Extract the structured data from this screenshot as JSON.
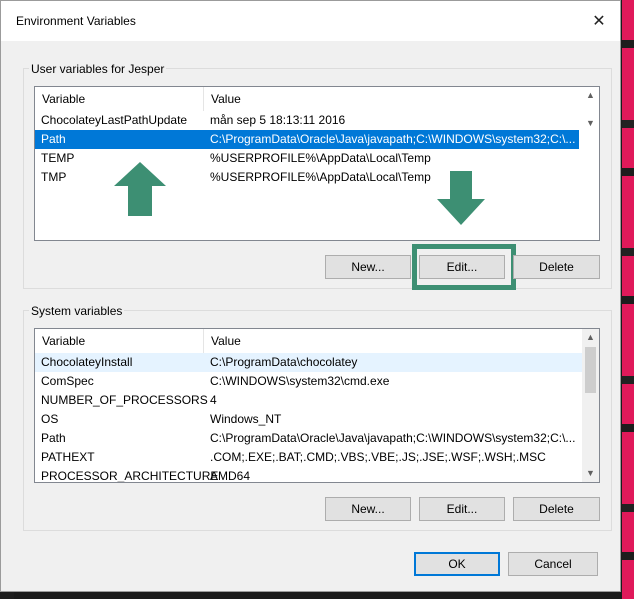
{
  "window": {
    "title": "Environment Variables",
    "close_glyph": "✕"
  },
  "user_group": {
    "label": "User variables for Jesper",
    "columns": [
      "Variable",
      "Value"
    ],
    "rows": [
      {
        "variable": "ChocolateyLastPathUpdate",
        "value": "mån sep  5 18:13:11 2016"
      },
      {
        "variable": "Path",
        "value": "C:\\ProgramData\\Oracle\\Java\\javapath;C:\\WINDOWS\\system32;C:\\..."
      },
      {
        "variable": "TEMP",
        "value": "%USERPROFILE%\\AppData\\Local\\Temp"
      },
      {
        "variable": "TMP",
        "value": "%USERPROFILE%\\AppData\\Local\\Temp"
      }
    ],
    "selected_row": "Path",
    "buttons": {
      "new": "New...",
      "edit": "Edit...",
      "delete": "Delete"
    }
  },
  "system_group": {
    "label": "System variables",
    "columns": [
      "Variable",
      "Value"
    ],
    "rows": [
      {
        "variable": "ChocolateyInstall",
        "value": "C:\\ProgramData\\chocolatey"
      },
      {
        "variable": "ComSpec",
        "value": "C:\\WINDOWS\\system32\\cmd.exe"
      },
      {
        "variable": "NUMBER_OF_PROCESSORS",
        "value": "4"
      },
      {
        "variable": "OS",
        "value": "Windows_NT"
      },
      {
        "variable": "Path",
        "value": "C:\\ProgramData\\Oracle\\Java\\javapath;C:\\WINDOWS\\system32;C:\\..."
      },
      {
        "variable": "PATHEXT",
        "value": ".COM;.EXE;.BAT;.CMD;.VBS;.VBE;.JS;.JSE;.WSF;.WSH;.MSC"
      },
      {
        "variable": "PROCESSOR_ARCHITECTURE",
        "value": "AMD64"
      }
    ],
    "buttons": {
      "new": "New...",
      "edit": "Edit...",
      "delete": "Delete"
    }
  },
  "footer": {
    "ok": "OK",
    "cancel": "Cancel"
  },
  "colors": {
    "selection": "#0078d7",
    "annotation": "#3d8f73"
  },
  "annotations": [
    "up-arrow-icon",
    "down-arrow-icon",
    "highlight-box"
  ]
}
